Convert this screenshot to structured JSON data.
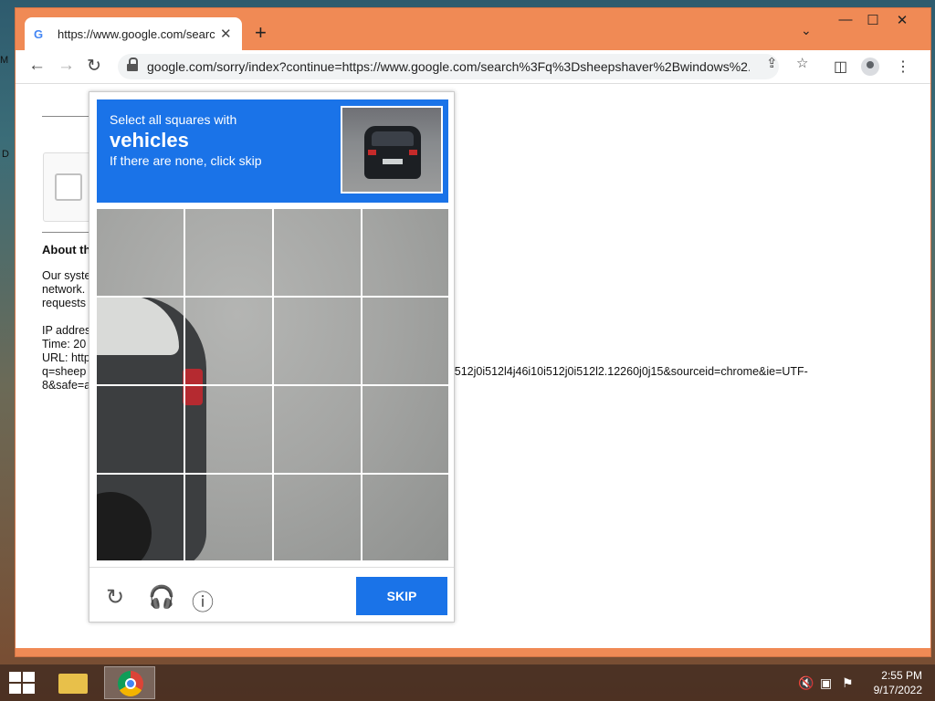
{
  "desktop": {
    "edge_text_1": "M",
    "edge_text_2": "D"
  },
  "browser": {
    "tab": {
      "title": "https://www.google.com/search?",
      "favicon": "G"
    },
    "window_controls": {
      "minimize": "—",
      "maximize": "☐",
      "close": "✕"
    },
    "address": "google.com/sorry/index?continue=https://www.google.com/search%3Fq%3Dsheepshaver%2Bwindows%2..."
  },
  "page": {
    "about_heading": "About th",
    "para_lines": [
      "Our syste",
      "network.",
      "requests"
    ],
    "ip_label": "IP addres",
    "time_label": "Time: 20",
    "url_label": "URL: http",
    "url_line2_left": "q=sheep",
    "url_line2_right": "i512j0i512l4j46i10i512j0i512l2.12260j0j15&sourceid=chrome&ie=UTF-",
    "url_line3": "8&safe=a"
  },
  "captcha": {
    "instruction_line1": "Select all squares with",
    "target_object": "vehicles",
    "instruction_line3": "If there are none, click skip",
    "skip_label": "SKIP",
    "grid_rows": 4,
    "grid_cols": 4
  },
  "taskbar": {
    "time": "2:55 PM",
    "date": "9/17/2022"
  }
}
